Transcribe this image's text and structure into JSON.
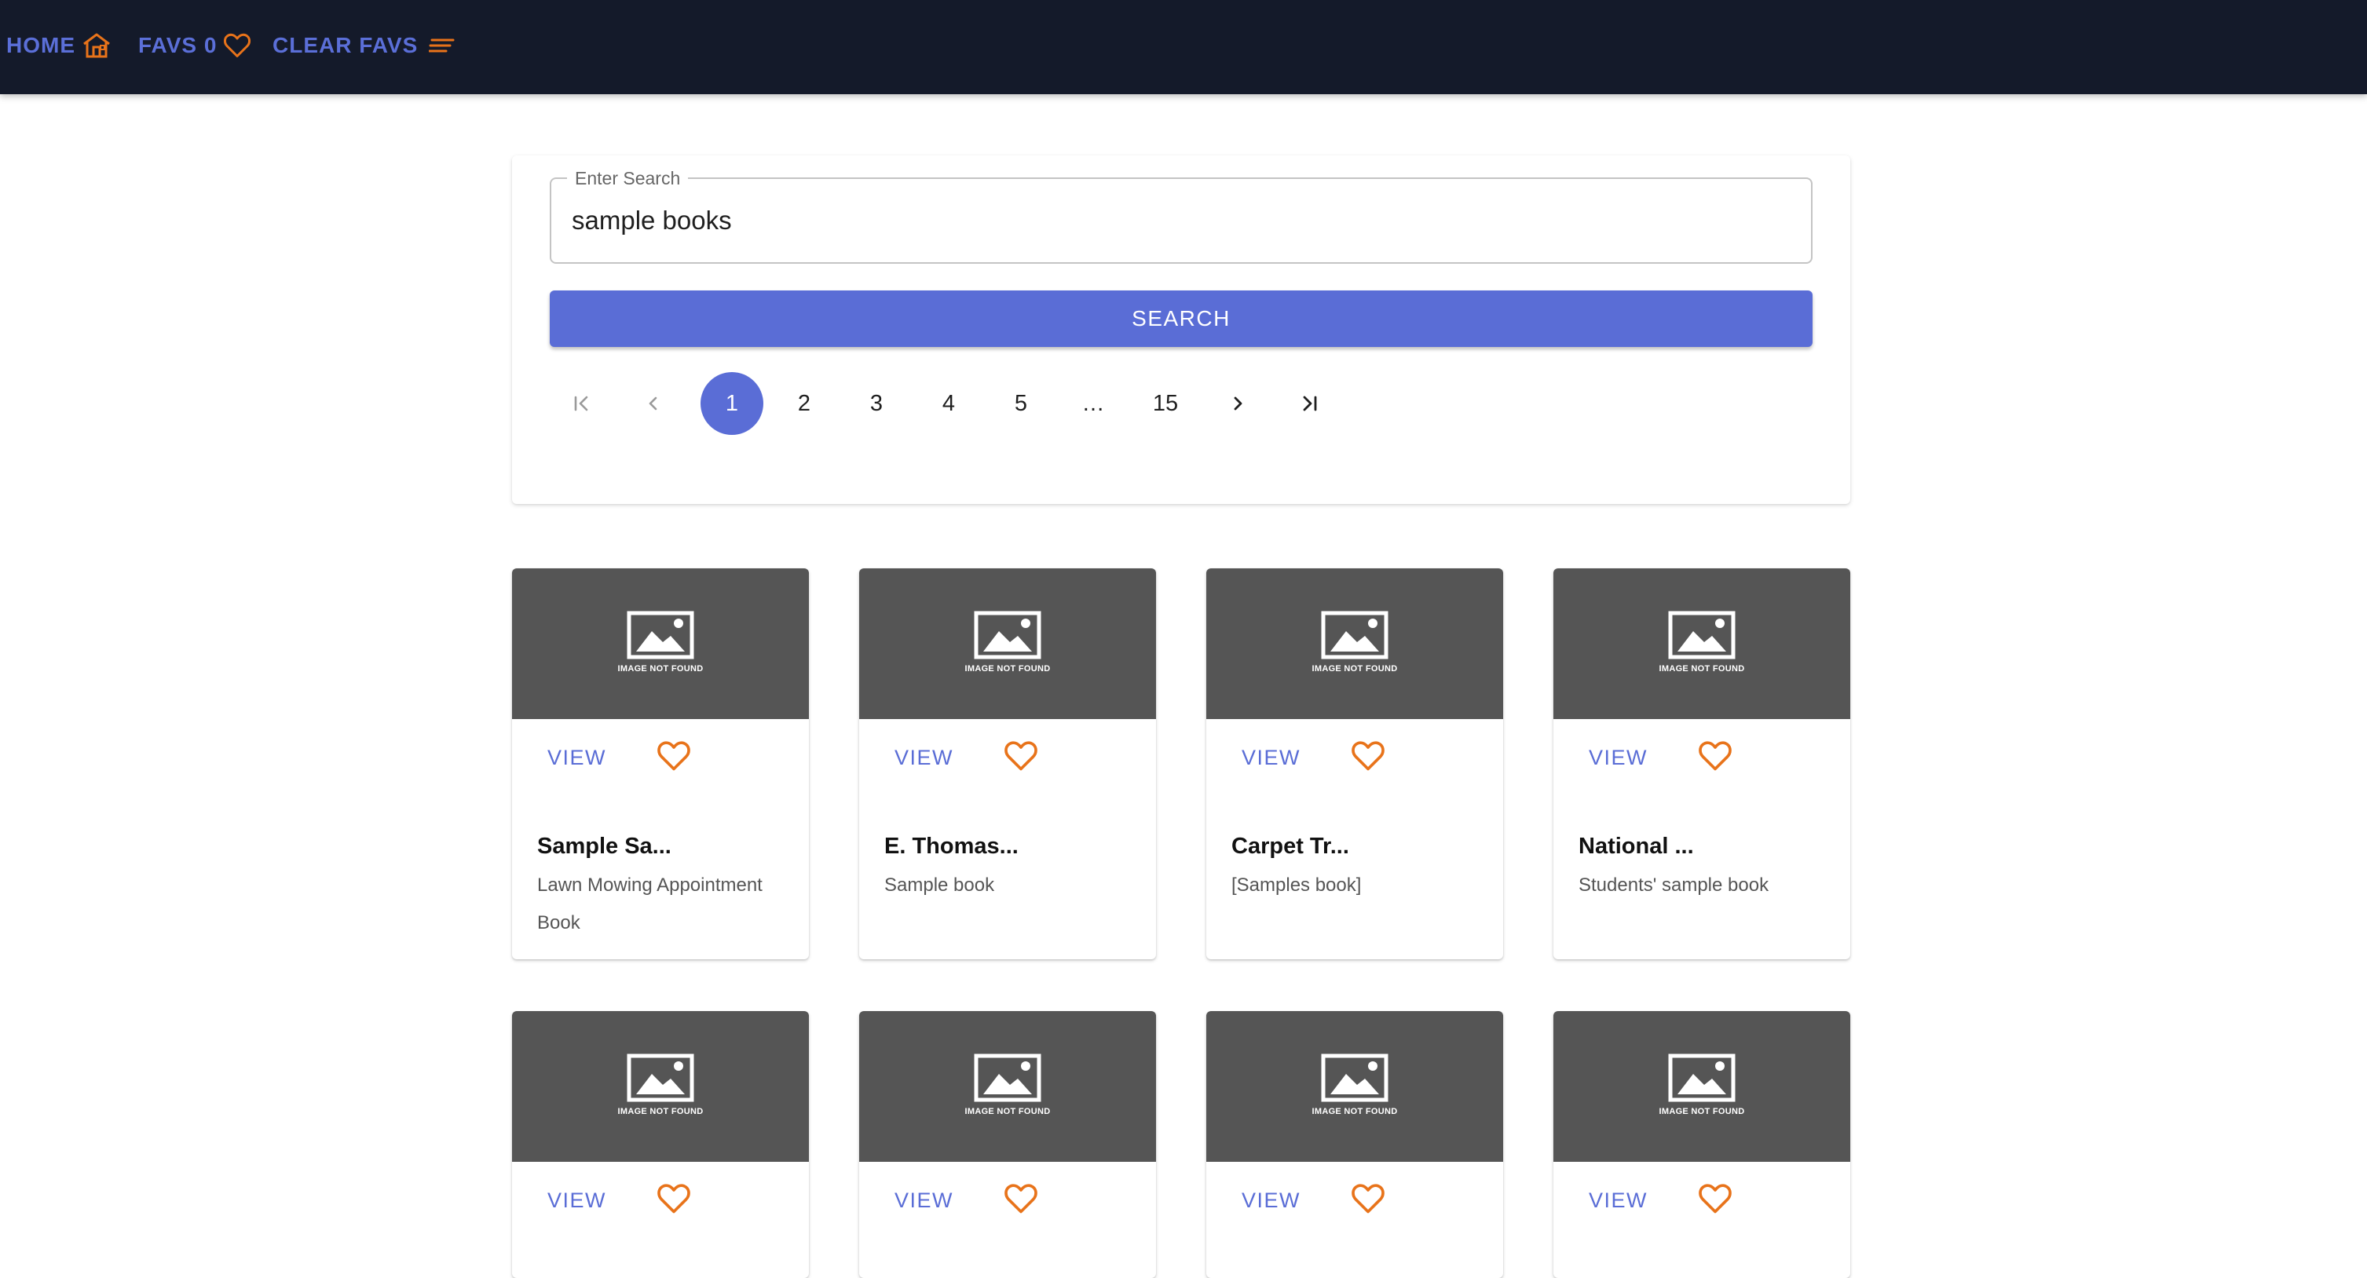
{
  "nav": {
    "home_label": "HOME",
    "favs_label": "FAVS 0",
    "clear_label": "CLEAR FAVS",
    "home_icon": "house-icon",
    "favs_icon": "heart-outline-icon",
    "clear_icon": "sort-lines-icon"
  },
  "search": {
    "legend": "Enter Search",
    "value": "sample books",
    "button_label": "SEARCH"
  },
  "pagination": {
    "pages": [
      "1",
      "2",
      "3",
      "4",
      "5",
      "…",
      "15"
    ],
    "current_page": "1"
  },
  "card_common": {
    "image_text": "IMAGE NOT FOUND",
    "view_label": "VIEW"
  },
  "cards": [
    {
      "title": "Sample Sa...",
      "subtitle": "Lawn Mowing Appointment Book"
    },
    {
      "title": "E. Thomas...",
      "subtitle": "Sample book"
    },
    {
      "title": "Carpet Tr...",
      "subtitle": "[Samples book]"
    },
    {
      "title": "National ...",
      "subtitle": "Students' sample book"
    }
  ],
  "colors": {
    "nav_bg": "#141a2a",
    "accent": "#5a6dd6",
    "icon_orange": "#e8731a",
    "placeholder_bg": "#555555"
  }
}
